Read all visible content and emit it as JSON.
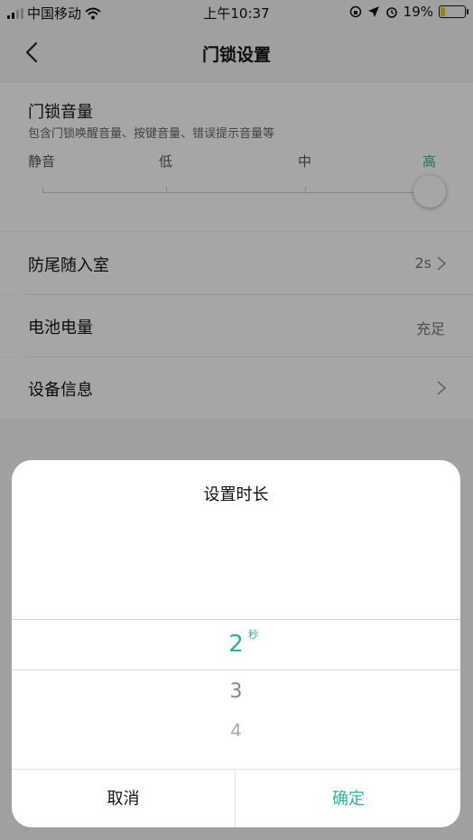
{
  "status_bar": {
    "carrier": "中国移动",
    "time": "上午10:37",
    "battery": "19%",
    "battery_level": 0.19
  },
  "nav": {
    "title": "门锁设置"
  },
  "volume": {
    "title": "门锁音量",
    "subtitle": "包含门锁唤醒音量、按键音量、错误提示音量等",
    "levels": [
      "静音",
      "低",
      "中",
      "高"
    ],
    "selected_level": "高"
  },
  "rows": [
    {
      "label": "防尾随入室",
      "value": "2s",
      "has_arrow": true
    },
    {
      "label": "电池电量",
      "value": "充足",
      "has_arrow": false
    },
    {
      "label": "设备信息",
      "value": "",
      "has_arrow": true
    }
  ],
  "dialog": {
    "title": "设置时长",
    "picker": {
      "selected": "2",
      "unit": "秒",
      "next": "3",
      "after": "4"
    },
    "cancel": "取消",
    "confirm": "确定"
  },
  "colors": {
    "accent": "#2bb39b",
    "battery": "#f5c518"
  }
}
